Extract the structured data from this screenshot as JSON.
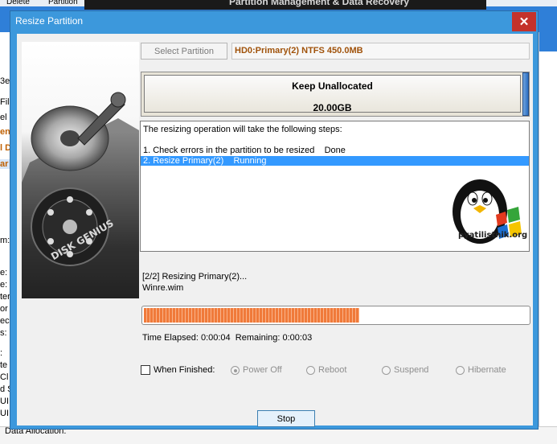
{
  "background_app": {
    "toolbar": {
      "delete_label": "Delete",
      "partition_label": "Partition"
    },
    "banner_text": "Partition Management & Data Recovery",
    "left_fragments": [
      "3e",
      "Fil",
      "el",
      "en",
      "l D",
      "ar",
      "m:",
      "e:",
      "e:",
      "ter",
      "or",
      "ec",
      "s:",
      ":",
      "te",
      "Cl",
      "d S",
      "UI",
      "UI"
    ],
    "status_text": "Data Allocation:"
  },
  "dialog": {
    "title": "Resize Partition",
    "close_glyph": "✕",
    "disk_logo_text": "DISK GENIUS",
    "select_partition_label": "Select Partition",
    "partition_info": "HD0:Primary(2) NTFS 450.0MB",
    "unallocated": {
      "label": "Keep Unallocated",
      "size": "20.00GB"
    },
    "steps": {
      "intro": "The resizing operation will take the following steps:",
      "items": [
        {
          "text": "1. Check errors in the partition to be resized    Done"
        },
        {
          "text": "2. Resize Primary(2)    Running"
        }
      ],
      "logo_text": "pyatilistnik.org"
    },
    "progress": {
      "status": "[2/2] Resizing Primary(2)...",
      "file": "Winre.wim",
      "fraction": 0.56,
      "time_elapsed_label": "Time Elapsed:",
      "time_elapsed": "0:00:04",
      "remaining_label": "Remaining:",
      "remaining": "0:00:03"
    },
    "when_finished": {
      "label": "When Finished:",
      "checked": false,
      "options": [
        "Power Off",
        "Reboot",
        "Suspend",
        "Hibernate"
      ],
      "selected": "Power Off"
    },
    "stop_label": "Stop"
  },
  "colors": {
    "titlebar": "#3c98dc",
    "close": "#c4322b",
    "progress": "#f07a3a",
    "partition_info": "#a0520a",
    "selection": "#3399ff"
  }
}
